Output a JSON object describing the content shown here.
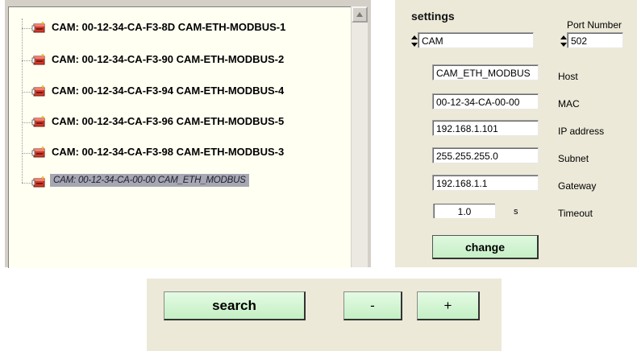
{
  "device_tree": {
    "items": [
      {
        "label": "CAM: 00-12-34-CA-F3-8D CAM-ETH-MODBUS-1",
        "selected": false
      },
      {
        "label": "CAM: 00-12-34-CA-F3-90 CAM-ETH-MODBUS-2",
        "selected": false
      },
      {
        "label": "CAM: 00-12-34-CA-F3-94 CAM-ETH-MODBUS-4",
        "selected": false
      },
      {
        "label": "CAM: 00-12-34-CA-F3-96 CAM-ETH-MODBUS-5",
        "selected": false
      },
      {
        "label": "CAM: 00-12-34-CA-F3-98 CAM-ETH-MODBUS-3",
        "selected": false
      },
      {
        "label": "CAM: 00-12-34-CA-00-00 CAM_ETH_MODBUS",
        "selected": true
      }
    ],
    "icon": "device-icon"
  },
  "settings": {
    "title": "settings",
    "type_value": "CAM",
    "port_label": "Port Number",
    "port_value": "502",
    "host_value": "CAM_ETH_MODBUS",
    "host_label": "Host",
    "mac_value": "00-12-34-CA-00-00",
    "mac_label": "MAC",
    "ip_value": "192.168.1.101",
    "ip_label": "IP address",
    "subnet_value": "255.255.255.0",
    "subnet_label": "Subnet",
    "gateway_value": "192.168.1.1",
    "gateway_label": "Gateway",
    "timeout_value": "1.0",
    "timeout_unit": "s",
    "timeout_label": "Timeout",
    "change_label": "change"
  },
  "toolbar": {
    "search_label": "search",
    "minus_label": "-",
    "plus_label": "+"
  },
  "colors": {
    "tree_background": "#fffff2",
    "selection_background": "#a6a7b3",
    "panel_background": "#ece9d8",
    "button_green": "#c6efc6"
  }
}
